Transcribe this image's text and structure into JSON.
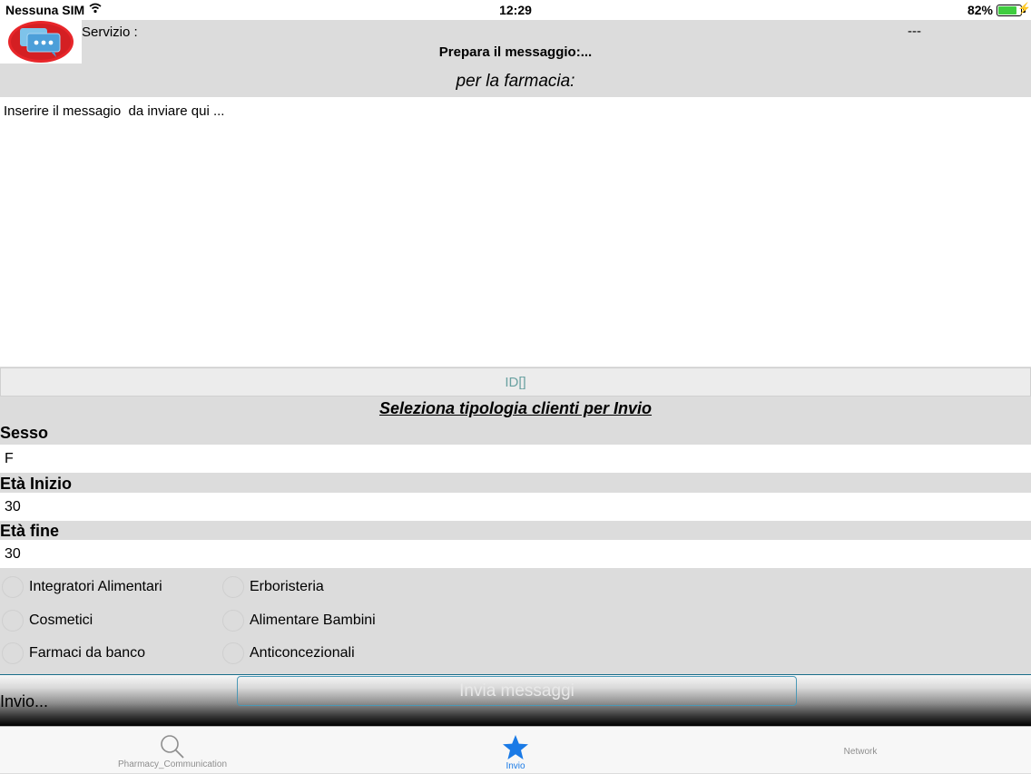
{
  "status": {
    "carrier": "Nessuna SIM",
    "time": "12:29",
    "battery": "82%",
    "battery_level": 0.82
  },
  "header": {
    "service_label": "Servizio :",
    "service_value": "---",
    "title": "Prepara il messaggio:...",
    "subtitle": "per la farmacia:"
  },
  "message": {
    "placeholder": "Inserire il messagio  da inviare qui ..."
  },
  "id_label": "ID[]",
  "filter": {
    "title": "Seleziona tipologia clienti per Invio",
    "sex_label": "Sesso",
    "sex_value": "F",
    "age_start_label": "Età Inizio",
    "age_start_value": "30",
    "age_end_label": "Età fine",
    "age_end_value": "30"
  },
  "categories": [
    "Integratori Alimentari",
    "Erboristeria",
    "Cosmetici",
    "Alimentare Bambini",
    "Farmaci da banco",
    "Anticoncezionali"
  ],
  "actions": {
    "status": "Invio...",
    "send_label": "Invia messaggi"
  },
  "tabs": [
    {
      "label": "Pharmacy_Communication",
      "icon": "search-icon"
    },
    {
      "label": "Invio",
      "icon": "star-icon",
      "active": true
    },
    {
      "label": "Network"
    }
  ],
  "colors": {
    "accent": "#1a7ae6",
    "panel": "#dcdcdc"
  }
}
